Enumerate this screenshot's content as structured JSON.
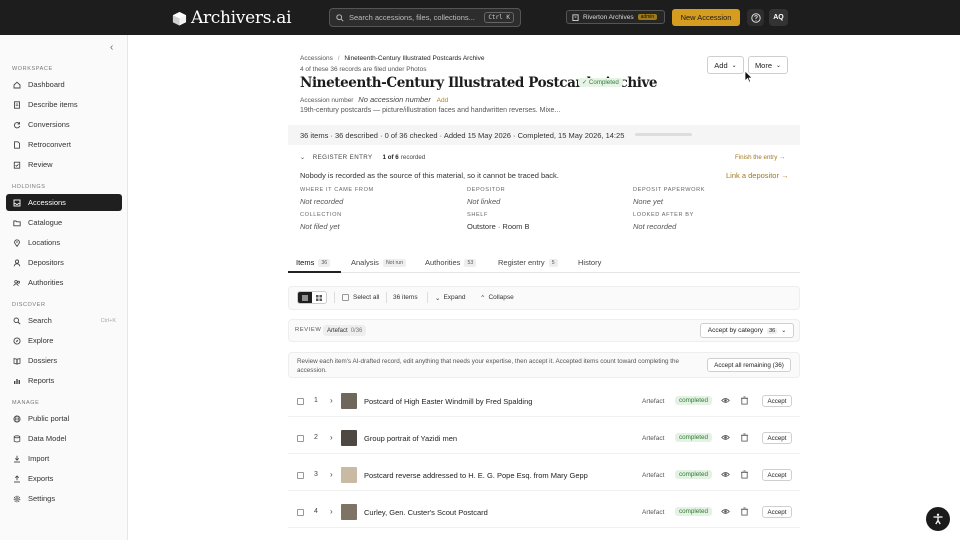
{
  "header": {
    "brand": "Archivers.ai",
    "search_placeholder": "Search accessions, files, collections...",
    "search_shortcut": "Ctrl K",
    "workspace": "Riverton Archives",
    "workspace_role": "admin",
    "new_accession": "New Accession",
    "avatar_initials": "AQ"
  },
  "sidebar": {
    "workspace_label": "WORKSPACE",
    "workspace_items": [
      "Dashboard",
      "Describe items",
      "Conversions",
      "Retroconvert",
      "Review"
    ],
    "holdings_label": "HOLDINGS",
    "holdings_items": [
      "Accessions",
      "Catalogue",
      "Locations",
      "Depositors",
      "Authorities"
    ],
    "discover_label": "DISCOVER",
    "discover_items": [
      "Search",
      "Explore",
      "Dossiers",
      "Reports"
    ],
    "search_hint": "Ctrl+K",
    "manage_label": "MANAGE",
    "manage_items": [
      "Public portal",
      "Data Model",
      "Import",
      "Exports",
      "Settings"
    ],
    "active_item": "Accessions"
  },
  "record": {
    "breadcrumb_root": "Accessions",
    "breadcrumb_sep": "/",
    "breadcrumb_current": "Nineteenth-Century Illustrated Postcards Archive",
    "filed_note": "4 of these 36 records are filed under Photos",
    "title": "Nineteenth-Century Illustrated Postcards Archive",
    "status": "✓ Completed",
    "accession_label": "Accession number",
    "accession_value": "No accession number",
    "accession_add": "Add",
    "description": "19th-century postcards — picture/illustration faces and handwritten reverses. Mixe...",
    "add_button": "Add",
    "more_button": "More",
    "stats": "36 items · 36 described · 0 of 36 checked · Added 15 May 2026 · Completed, 15 May 2026, 14:25",
    "progress": 0
  },
  "register": {
    "label": "REGISTER ENTRY",
    "count_prefix": "1 of 6",
    "count_suffix": "recorded",
    "finish_link": "Finish the entry →",
    "notice": "Nobody is recorded as the source of this material, so it cannot be traced back.",
    "link_depositor": "Link a depositor →",
    "fields": [
      {
        "label": "WHERE IT CAME FROM",
        "value": "Not recorded",
        "empty": true
      },
      {
        "label": "DEPOSITOR",
        "value": "Not linked",
        "empty": true
      },
      {
        "label": "DEPOSIT PAPERWORK",
        "value": "None yet",
        "empty": true
      },
      {
        "label": "COLLECTION",
        "value": "Not filed yet",
        "empty": true
      },
      {
        "label": "SHELF",
        "value": "Outstore · Room B",
        "empty": false
      },
      {
        "label": "LOOKED AFTER BY",
        "value": "Not recorded",
        "empty": true
      }
    ]
  },
  "tabs": [
    {
      "label": "Items",
      "count": "36"
    },
    {
      "label": "Analysis",
      "count": "Not run"
    },
    {
      "label": "Authorities",
      "count": "53"
    },
    {
      "label": "Register entry",
      "count": "5"
    },
    {
      "label": "History",
      "count": ""
    }
  ],
  "toolbar": {
    "select_all": "Select all",
    "item_count": "36 items",
    "expand": "Expand",
    "collapse": "Collapse"
  },
  "review": {
    "label": "REVIEW",
    "chip": "Artefact",
    "chip_count": "0/36",
    "accept_by_category": "Accept by category",
    "accept_by_category_count": "36",
    "note": "Review each item's AI-drafted record, edit anything that needs your expertise, then accept it. Accepted items count toward completing the accession.",
    "accept_all": "Accept all remaining (36)"
  },
  "items": [
    {
      "num": "1",
      "name": "Postcard of High Easter Windmill by Fred Spalding",
      "type": "Artefact",
      "status": "completed",
      "action": "Accept",
      "thumb": "#6f665c"
    },
    {
      "num": "2",
      "name": "Group portrait of Yazidi men",
      "type": "Artefact",
      "status": "completed",
      "action": "Accept",
      "thumb": "#4d4842"
    },
    {
      "num": "3",
      "name": "Postcard reverse addressed to H. E. G. Pope Esq. from Mary Gepp",
      "type": "Artefact",
      "status": "completed",
      "action": "Accept",
      "thumb": "#c9bba3"
    },
    {
      "num": "4",
      "name": "Curley, Gen. Custer's Scout Postcard",
      "type": "Artefact",
      "status": "completed",
      "action": "Accept",
      "thumb": "#7d7466"
    }
  ]
}
